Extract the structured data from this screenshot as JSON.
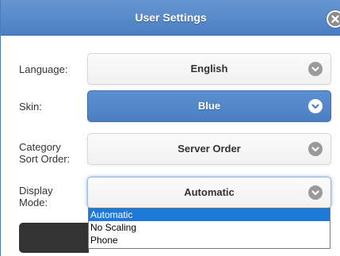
{
  "dialog": {
    "title": "User Settings"
  },
  "settings": [
    {
      "label": "Language:",
      "value": "English"
    },
    {
      "label": "Skin:",
      "value": "Blue"
    },
    {
      "label": "Category Sort Order:",
      "value": "Server Order"
    },
    {
      "label": "Display Mode:",
      "value": "Automatic"
    }
  ],
  "display_mode_options": [
    "Automatic",
    "No Scaling",
    "Phone"
  ],
  "display_mode_selected_option": "Automatic",
  "icons": {
    "close": "close-circle-icon",
    "dropdown": "chevron-down-circle-icon"
  },
  "colors": {
    "header_blue": "#4a7fc2",
    "active_field_blue": "#5d8fd0",
    "selected_option_blue": "#1e78d7"
  }
}
